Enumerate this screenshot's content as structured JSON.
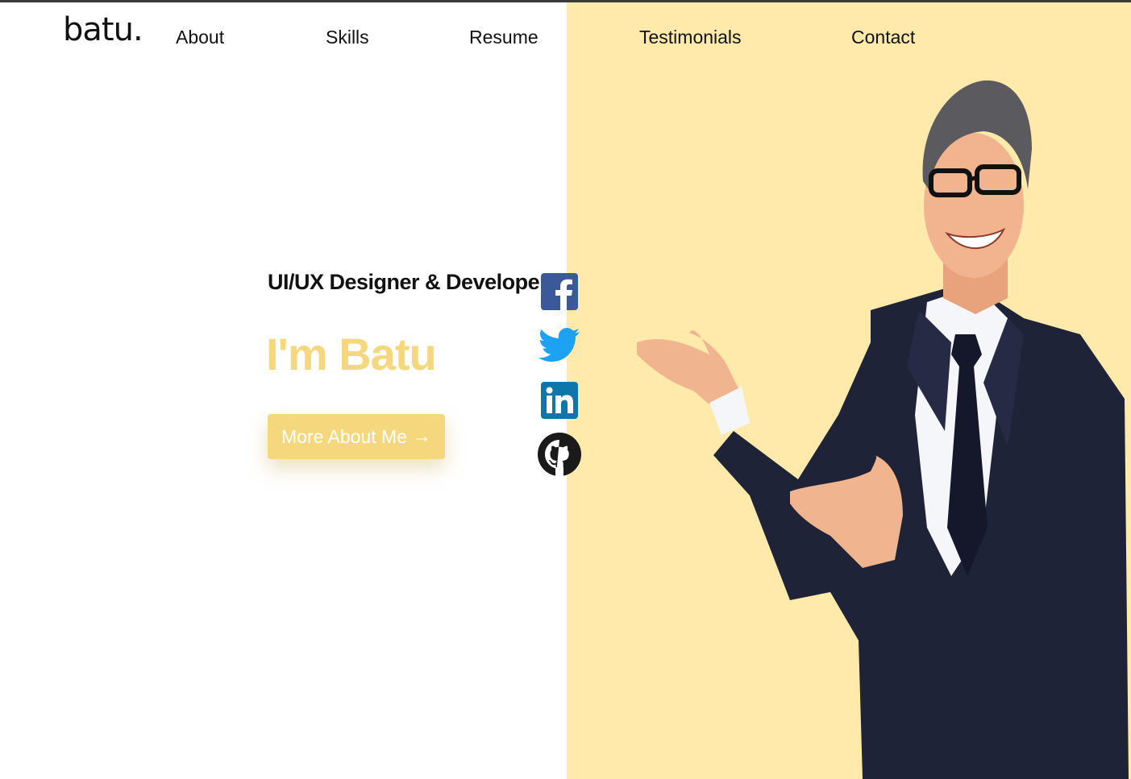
{
  "brand": {
    "logo": "batu."
  },
  "nav": {
    "items": [
      {
        "label": "About"
      },
      {
        "label": "Skills"
      },
      {
        "label": "Resume"
      },
      {
        "label": "Testimonials"
      },
      {
        "label": "Contact"
      }
    ]
  },
  "hero": {
    "subtitle": "UI/UX Designer & Developer",
    "headline": "I'm Batu",
    "cta_label": "More About Me",
    "cta_icon": "arrow-right-icon"
  },
  "social": {
    "icons": [
      "facebook-icon",
      "twitter-icon",
      "linkedin-icon",
      "github-icon"
    ]
  },
  "colors": {
    "accent": "#f5d77e",
    "panel": "#ffeaab",
    "text": "#111111",
    "facebook": "#3b5998",
    "twitter": "#1da1f2",
    "linkedin": "#0e76a8"
  }
}
